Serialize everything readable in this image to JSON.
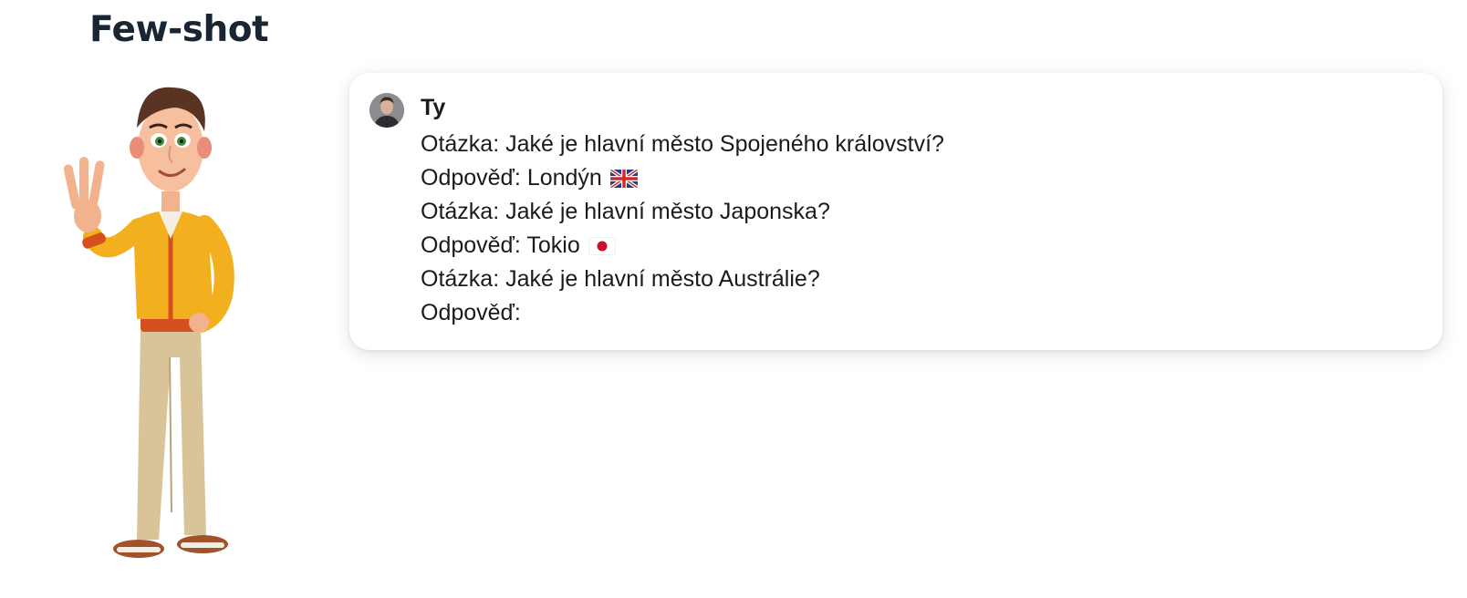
{
  "page": {
    "title": "Few-shot"
  },
  "illustration": {
    "icon": "waving-cartoon-man-icon"
  },
  "chat": {
    "sender": "Ty",
    "avatar_icon": "user-avatar-icon",
    "lines": [
      {
        "text": "Otázka: Jaké je hlavní město Spojeného království?"
      },
      {
        "text": "Odpověď: Londýn",
        "flag": "uk-flag-icon"
      },
      {
        "text": "Otázka: Jaké je hlavní město Japonska?"
      },
      {
        "text": "Odpověď: Tokio",
        "flag": "japan-flag-icon"
      },
      {
        "text": "Otázka: Jaké je hlavní město Austrálie?"
      },
      {
        "text": "Odpověď:"
      }
    ]
  },
  "colors": {
    "title": "#1a2533",
    "text": "#1b1b1b",
    "jacket": "#f2b01e",
    "pants": "#d9c49a"
  }
}
